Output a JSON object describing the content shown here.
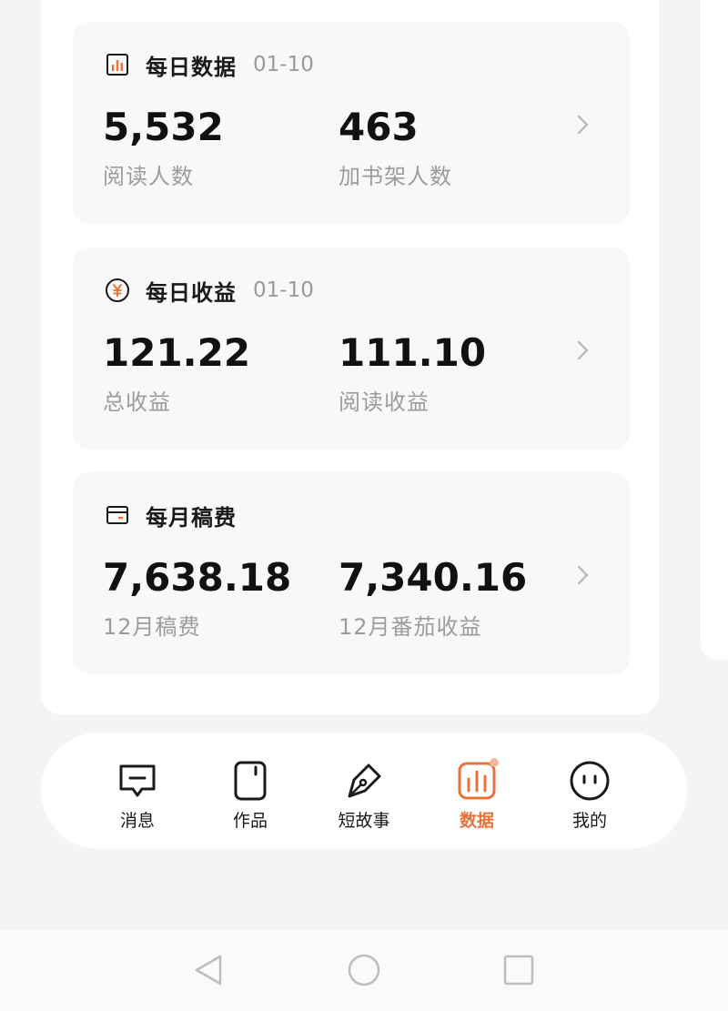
{
  "cards": [
    {
      "title": "每日数据",
      "date": "01-10",
      "icon": "bar-chart-icon",
      "metrics": [
        {
          "value": "5,532",
          "label": "阅读人数"
        },
        {
          "value": "463",
          "label": "加书架人数"
        }
      ]
    },
    {
      "title": "每日收益",
      "date": "01-10",
      "icon": "yuan-coin-icon",
      "metrics": [
        {
          "value": "121.22",
          "label": "总收益"
        },
        {
          "value": "111.10",
          "label": "阅读收益"
        }
      ]
    },
    {
      "title": "每月稿费",
      "icon": "wallet-card-icon",
      "metrics": [
        {
          "value": "7,638.18",
          "label": "12月稿费"
        },
        {
          "value": "7,340.16",
          "label": "12月番茄收益"
        }
      ]
    }
  ],
  "nav": [
    {
      "label": "消息",
      "icon": "message-icon",
      "active": false
    },
    {
      "label": "作品",
      "icon": "book-icon",
      "active": false
    },
    {
      "label": "短故事",
      "icon": "pen-nib-icon",
      "active": false
    },
    {
      "label": "数据",
      "icon": "data-chart-icon",
      "active": true
    },
    {
      "label": "我的",
      "icon": "face-icon",
      "active": false
    }
  ],
  "system_nav": [
    "back-icon",
    "home-icon",
    "recents-icon"
  ],
  "colors": {
    "accent": "#e8733a",
    "text": "#111111",
    "muted": "#9c9c9c",
    "card": "#f8f8f8"
  }
}
